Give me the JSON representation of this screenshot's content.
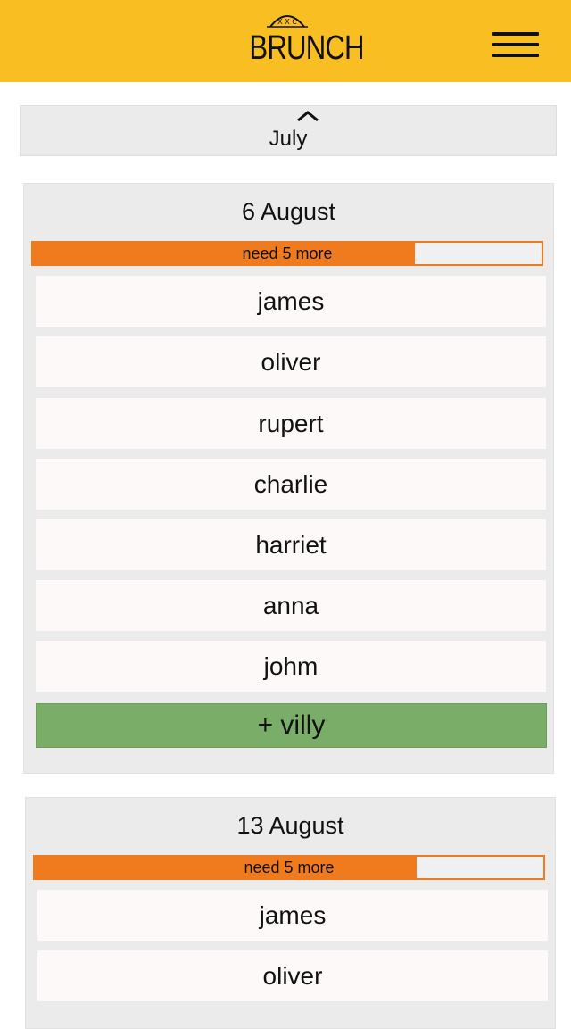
{
  "header": {
    "logo_text": "BRUNCH",
    "logo_small_text": "X X C"
  },
  "month_nav": {
    "label": "July"
  },
  "weeks": [
    {
      "date": "6 August",
      "progress_label": "need 5 more",
      "progress_fraction": 0.75,
      "attendees": [
        "james",
        "oliver",
        "rupert",
        "charlie",
        "harriet",
        "anna",
        "johm"
      ],
      "add_label": "+  villy"
    },
    {
      "date": "13 August",
      "progress_label": "need 5 more",
      "progress_fraction": 0.75,
      "attendees": [
        "james",
        "oliver"
      ]
    }
  ],
  "colors": {
    "header": "#f8be22",
    "progress": "#f07a1e",
    "add_button": "#7aae68",
    "card": "#ebebeb"
  }
}
